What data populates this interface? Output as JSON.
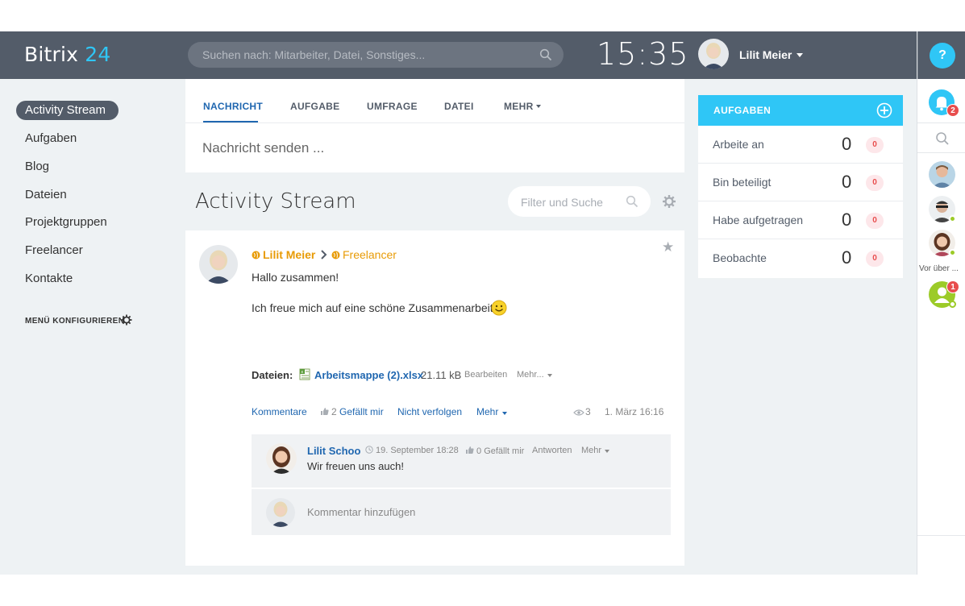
{
  "header": {
    "logo_text": "Bitrix",
    "logo_number": "24",
    "search_placeholder": "Suchen nach: Mitarbeiter, Datei, Sonstiges...",
    "clock": "15:35",
    "user_name": "Lilit Meier",
    "help_label": "?"
  },
  "nav": {
    "items": [
      "Activity Stream",
      "Aufgaben",
      "Blog",
      "Dateien",
      "Projektgruppen",
      "Freelancer",
      "Kontakte"
    ],
    "configure_label": "MENÜ KONFIGURIEREN"
  },
  "composer": {
    "tabs": [
      "NACHRICHT",
      "AUFGABE",
      "UMFRAGE",
      "DATEI",
      "MEHR"
    ],
    "placeholder": "Nachricht senden ..."
  },
  "stream": {
    "title": "Activity Stream",
    "filter_placeholder": "Filter und Suche"
  },
  "post": {
    "author": "Lilit Meier",
    "destination": "Freelancer",
    "line1": "Hallo zusammen!",
    "line2": "Ich freue mich auf eine schöne Zusammenarbeit",
    "files_label": "Dateien:",
    "file_name": "Arbeitsmappe (2).xlsx",
    "file_size": "21.11 kB",
    "file_edit": "Bearbeiten",
    "file_more": "Mehr...",
    "actions": {
      "comments": "Kommentare",
      "likes_count": "2",
      "like_label": "Gefällt mir",
      "unfollow": "Nicht verfolgen",
      "more": "Mehr"
    },
    "views": "3",
    "date": "1. März 16:16"
  },
  "comment": {
    "author": "Lilit Schoo",
    "time": "19. September 18:28",
    "likes_count": "0",
    "like_label": "Gefällt mir",
    "reply": "Antworten",
    "more": "Mehr",
    "text": "Wir freuen uns auch!",
    "add_placeholder": "Kommentar hinzufügen"
  },
  "tasks": {
    "title": "AUFGABEN",
    "rows": [
      {
        "label": "Arbeite an",
        "count": "0",
        "badge": "0"
      },
      {
        "label": "Bin beteiligt",
        "count": "0",
        "badge": "0"
      },
      {
        "label": "Habe aufgetragen",
        "count": "0",
        "badge": "0"
      },
      {
        "label": "Beobachte",
        "count": "0",
        "badge": "0"
      }
    ]
  },
  "rightpanel": {
    "notification_count": "2",
    "more_label": "Vor über ...",
    "contact_badge": "1"
  },
  "colors": {
    "header_bg": "#535c69",
    "accent": "#2fc6f6",
    "link": "#2067b0",
    "author_orange": "#e89b06",
    "badge_red": "#e84d4d"
  }
}
